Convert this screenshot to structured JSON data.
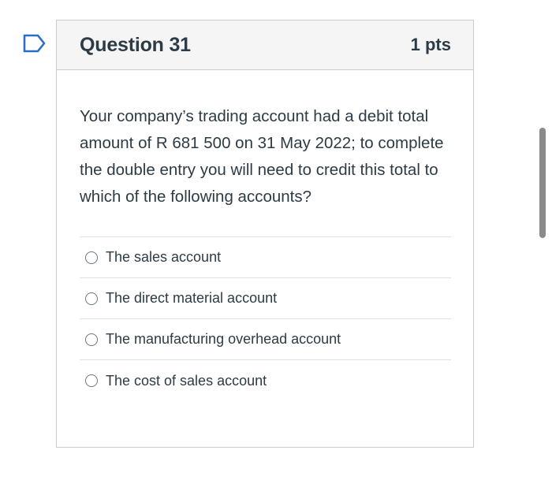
{
  "question": {
    "title": "Question 31",
    "points": "1 pts",
    "text": "Your company’s trading account had a debit total amount of R 681 500 on 31 May 2022; to complete the double entry you will need to credit this total to which of the following accounts?",
    "flag_icon": "bookmark-flag-icon",
    "answers": [
      {
        "label": "The sales account"
      },
      {
        "label": "The direct material account"
      },
      {
        "label": "The manufacturing overhead account"
      },
      {
        "label": "The cost of sales account"
      }
    ]
  },
  "colors": {
    "text": "#2d3b45",
    "header_bg": "#f5f5f5",
    "border": "#c7cdd1",
    "flag": "#2b6fc4"
  }
}
